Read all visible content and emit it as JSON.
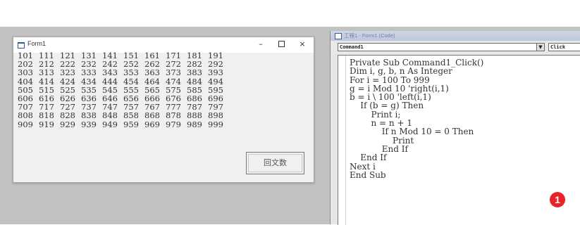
{
  "form_window": {
    "title": "Form1",
    "controls": {
      "minimize": "–",
      "close": "×"
    },
    "numbers": [
      [
        "101",
        "111",
        "121",
        "131",
        "141",
        "151",
        "161",
        "171",
        "181",
        "191"
      ],
      [
        "202",
        "212",
        "222",
        "232",
        "242",
        "252",
        "262",
        "272",
        "282",
        "292"
      ],
      [
        "303",
        "313",
        "323",
        "333",
        "343",
        "353",
        "363",
        "373",
        "383",
        "393"
      ],
      [
        "404",
        "414",
        "424",
        "434",
        "444",
        "454",
        "464",
        "474",
        "484",
        "494"
      ],
      [
        "505",
        "515",
        "525",
        "535",
        "545",
        "555",
        "565",
        "575",
        "585",
        "595"
      ],
      [
        "606",
        "616",
        "626",
        "636",
        "646",
        "656",
        "666",
        "676",
        "686",
        "696"
      ],
      [
        "707",
        "717",
        "727",
        "737",
        "747",
        "757",
        "767",
        "777",
        "787",
        "797"
      ],
      [
        "808",
        "818",
        "828",
        "838",
        "848",
        "858",
        "868",
        "878",
        "888",
        "898"
      ],
      [
        "909",
        "919",
        "929",
        "939",
        "949",
        "959",
        "969",
        "979",
        "989",
        "999"
      ]
    ],
    "button_label": "回文数"
  },
  "code_window": {
    "title": "工程1 - Form1 (Code)",
    "object_select": "Command1",
    "procedure_select": "Click",
    "dropdown_arrow": "▼",
    "code_lines": [
      "Private Sub Command1_Click()",
      "Dim i, g, b, n As Integer",
      "For i = 100 To 999",
      "g = i Mod 10 'right(i,1)",
      "b = i \\ 100 'left(i,1)",
      "    If (b = g) Then",
      "        Print i;",
      "        n = n + 1",
      "            If n Mod 10 = 0 Then",
      "                Print",
      "            End If",
      "    End If",
      "Next i",
      "End Sub"
    ]
  },
  "badge": {
    "label": "1",
    "color": "#e8242a"
  }
}
